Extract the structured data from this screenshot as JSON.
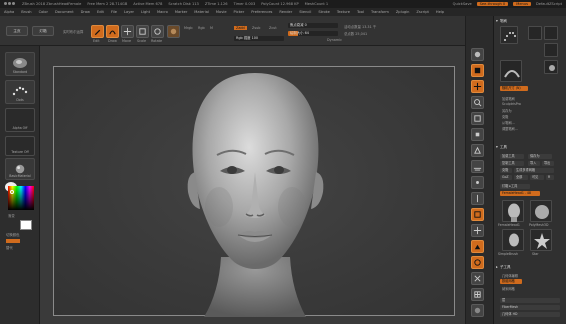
{
  "titlebar": {
    "items": [
      "ZBrush 2018",
      "ZBrush 2018 ZbrushHeadFemale",
      "Free Mem 2 28.714GB",
      "Active Mem 678",
      "Scratch Disk 113",
      "ZTime 1.126",
      "Timer 0.003",
      "PolyCount 12.968 KP",
      "MeshCount 1"
    ],
    "quicksave": "QuickSave",
    "see_through": "See-through 0",
    "menus": "Menus",
    "default_zscript": "DefaultZScript"
  },
  "menubar": {
    "items": [
      "Alpha",
      "Brush",
      "Color",
      "Document",
      "Draw",
      "Edit",
      "File",
      "Layer",
      "Light",
      "Macro",
      "Marker",
      "Material",
      "Movie",
      "Picker",
      "Preferences",
      "Render",
      "Stencil",
      "Stroke",
      "Texture",
      "Tool",
      "Transform",
      "Zplugin",
      "Zscript",
      "Help"
    ]
  },
  "toolbar": {
    "btn_home": "主页",
    "btn_lightbox": "灯箱",
    "btn_livebool": "实时布尔运算",
    "edit_label": "Edit",
    "draw_label": "Draw",
    "move_label": "Move",
    "scale_label": "Scale",
    "rotate_label": "Rotate",
    "mrgb": "Mrgb",
    "rgb": "Rgb",
    "m": "M",
    "zadd": "Zadd",
    "zsub": "Zsub",
    "zcut": "Zcut",
    "focal_shift": "焦点衰减 0",
    "draw_size": "绘制大小 64",
    "dynamic": "Dynamic",
    "active_points": "活动点数量 13.31 千",
    "total_points": "总点数 25,041",
    "rgb_intensity": "Rgb 强度 100",
    "z_intensity": "Z 强度 25"
  },
  "leftshelf": {
    "standard": "Standard",
    "dots": "Dots",
    "alpha_off": "Alpha Off",
    "texture_off": "Texture Off",
    "basic_material": "BasicMaterial",
    "gradient": "渐变",
    "switch_color": "切换颜色",
    "alternate": "替代"
  },
  "tray": {
    "header": "笔刷",
    "brush_names": [
      "Standard",
      "Stroke",
      "Alpha",
      "Dots",
      "Texture",
      "Spray"
    ],
    "brush_size_label": "随机尺寸 (N)",
    "menu_items": [
      "加载笔刷",
      "SculptrisPro",
      "另存为",
      "克隆",
      "从笔刷...",
      "调整笔刷..."
    ],
    "section_tool": "工具",
    "tool_buttons": [
      "加载工具",
      "保存为",
      "复制工具",
      "导入",
      "导出",
      "克隆",
      "生成多重网格",
      "GoZ",
      "全部",
      "可见",
      "R"
    ],
    "lightbox_tools": "灯箱 ▸工具",
    "tool_name": "FemaleHead1 . 48",
    "tool_thumbs": [
      "FemaleHead1",
      "PolyMesh3D",
      "SimpleBrush",
      "Star"
    ],
    "subtool": "子工具",
    "subtool_items": [
      "几何体编辑",
      "数组网格",
      "纳米网格"
    ],
    "bottom_rows": [
      "层",
      "FiberMesh",
      "几何体 HD"
    ]
  },
  "rightstrip": {
    "buttons": [
      "bpr",
      "SPix 3",
      "Scroll",
      "Zoom",
      "Actual",
      "AAHalf",
      "Persp",
      "Floor",
      "Local",
      "LSym",
      "Frame",
      "Move",
      "Scale",
      "Rotate",
      "Line Fill",
      "PolyF",
      "Transp",
      "Ghost",
      "Solo",
      "Xpose"
    ]
  },
  "viewport": {
    "subject": "female head sculpt"
  },
  "colors": {
    "accent": "#d06b1d",
    "background": "#3a3a3a",
    "panel": "#303030"
  }
}
